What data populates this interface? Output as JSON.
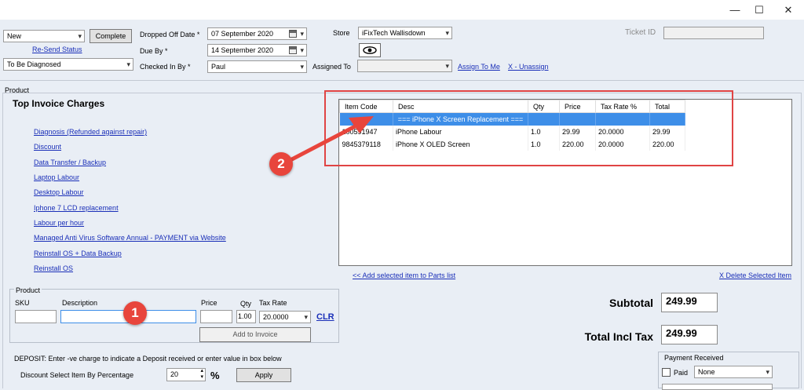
{
  "window": {
    "minimize": "—",
    "maximize": "☐",
    "close": "✕"
  },
  "header": {
    "status_value": "New",
    "complete_label": "Complete",
    "resend_label": "Re-Send Status",
    "diagnosis_value": "To Be Diagnosed",
    "dropped_label": "Dropped Off Date *",
    "dropped_value": "07 September 2020",
    "due_label": "Due By *",
    "due_value": "14 September 2020",
    "checkedin_label": "Checked In By *",
    "checkedin_value": "Paul",
    "store_label": "Store",
    "store_value": "iFixTech Wallisdown",
    "assigned_label": "Assigned To",
    "assign_me_label": "Assign To Me",
    "unassign_label": "X - Unassign",
    "ticket_label": "Ticket ID"
  },
  "product_section_label": "Product",
  "charges": {
    "title": "Top Invoice Charges",
    "items": [
      "Diagnosis (Refunded against repair)",
      "Discount",
      "Data Transfer / Backup",
      "Laptop Labour",
      "Desktop Labour",
      "Iphone 7 LCD replacement",
      "Labour per hour",
      "Managed Anti Virus Software Annual - PAYMENT via Website",
      "Reinstall OS + Data Backup",
      "Reinstall OS"
    ]
  },
  "grid": {
    "columns": [
      "Item Code",
      "Desc",
      "Qty",
      "Price",
      "Tax Rate %",
      "Total"
    ],
    "rows": [
      {
        "code": "",
        "desc": "=== iPhone X Screen Replacement ===",
        "qty": "",
        "price": "",
        "tax": "",
        "total": ""
      },
      {
        "code": "100591947",
        "desc": "iPhone Labour",
        "qty": "1.0",
        "price": "29.99",
        "tax": "20.0000",
        "total": "29.99"
      },
      {
        "code": "9845379118",
        "desc": "iPhone X OLED Screen",
        "qty": "1.0",
        "price": "220.00",
        "tax": "20.0000",
        "total": "220.00"
      }
    ]
  },
  "annotations": {
    "badge1": "1",
    "badge2": "2",
    "arrow_color": "#e8453c"
  },
  "links": {
    "add_selected": "<< Add selected item to Parts list",
    "delete_selected": "X Delete Selected Item"
  },
  "product_form": {
    "title": "Product",
    "sku_label": "SKU",
    "desc_label": "Description",
    "price_label": "Price",
    "qty_label": "Qty",
    "qty_value": "1.00",
    "tax_label": "Tax Rate",
    "tax_value": "20.0000",
    "clr_label": "CLR",
    "add_label": "Add to Invoice"
  },
  "deposit": {
    "note": "DEPOSIT: Enter -ve charge to indicate a Deposit received or enter value in box below",
    "discount_label": "Discount Select Item By Percentage",
    "discount_value": "20",
    "percent_symbol": "%",
    "apply_label": "Apply"
  },
  "totals": {
    "subtotal_label": "Subtotal",
    "subtotal_value": "249.99",
    "total_label": "Total Incl Tax",
    "total_value": "249.99"
  },
  "payment": {
    "title": "Payment Received",
    "paid_label": "Paid",
    "method_value": "None"
  }
}
